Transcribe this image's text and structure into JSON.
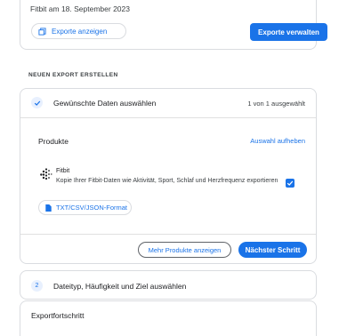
{
  "previous_export": {
    "text": "Fitbit am 18. September 2023",
    "show_exports_label": "Exporte anzeigen",
    "manage_exports_label": "Exporte verwalten"
  },
  "new_export": {
    "heading": "NEUEN EXPORT ERSTELLEN",
    "step1": {
      "title": "Gewünschte Daten auswählen",
      "count": "1 von 1 ausgewählt"
    },
    "products": {
      "label": "Produkte",
      "deselect_label": "Auswahl aufheben",
      "items": [
        {
          "name": "Fitbit",
          "description": "Kopie Ihrer Fitbit-Daten wie Aktivität, Sport, Schlaf und Herzfrequenz exportieren",
          "format_label": "TXT/CSV/JSON-Format",
          "checked": true
        }
      ]
    },
    "more_products_label": "Mehr Produkte anzeigen",
    "next_step_label": "Nächster Schritt",
    "step2": {
      "number": "2",
      "title": "Dateityp, Häufigkeit und Ziel auswählen"
    },
    "progress_title": "Exportfortschritt"
  },
  "colors": {
    "accent": "#1a73e8",
    "border": "#dadce0",
    "light_accent": "#e8f0fe"
  }
}
